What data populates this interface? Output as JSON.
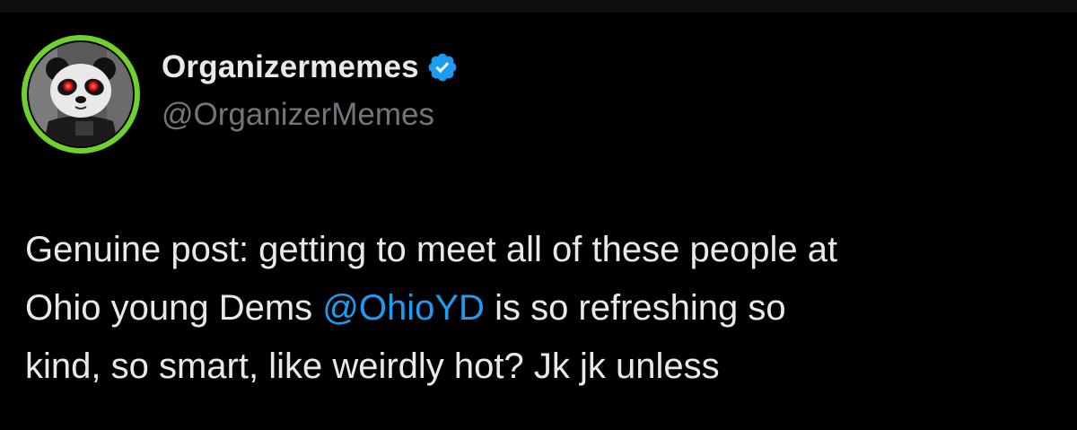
{
  "author": {
    "display_name": "Organizermemes",
    "handle": "@OrganizerMemes",
    "verified": true,
    "avatar_icon": "panda-avatar-icon",
    "avatar_ring_color": "#6fd12c"
  },
  "tweet": {
    "line1": "Genuine post: getting to meet all of these people at",
    "line2_before": "Ohio young Dems ",
    "line2_mention": "@OhioYD",
    "line2_after": " is so refreshing so",
    "line3": "kind, so smart, like weirdly hot? Jk jk unless"
  },
  "colors": {
    "background": "#000000",
    "text": "#e7e9ea",
    "secondary": "#71767b",
    "link": "#1d9bf0",
    "verified_badge": "#1d9bf0"
  }
}
